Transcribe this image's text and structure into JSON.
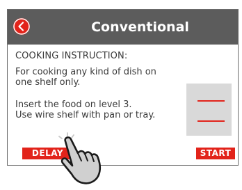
{
  "header": {
    "title": "Conventional",
    "back_icon": "chevron-left-icon"
  },
  "content": {
    "section_label": "COOKING INSTRUCTION:",
    "paragraph1": [
      "For cooking any kind of dish on",
      "one shelf only."
    ],
    "paragraph2": [
      "Insert the food on level 3.",
      "Use wire shelf with pan or tray."
    ],
    "illustration": "oven-shelf-level-icon"
  },
  "buttons": {
    "delay": "DELAY",
    "start": "START"
  },
  "colors": {
    "accent": "#e2231a",
    "header_bg": "#5c5c5c",
    "illustration_bg": "#d9d9d9"
  },
  "overlay": {
    "icon": "pointing-hand-icon"
  }
}
